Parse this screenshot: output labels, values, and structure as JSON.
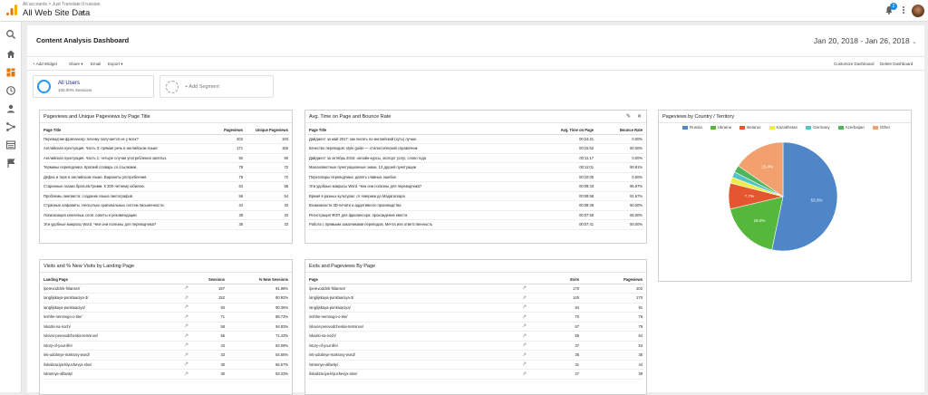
{
  "header": {
    "breadcrumb": "All accounts > Just Translate It russian",
    "account_view": "All Web Site Data",
    "notifications_count": "2"
  },
  "dashboard": {
    "title": "Content Analysis Dashboard",
    "date_range": "Jan 20, 2018 - Jan 26, 2018"
  },
  "toolbar": {
    "add_widget": "+ Add Widget",
    "share": "Share",
    "email": "Email",
    "export": "Export",
    "customize": "Customize Dashboard",
    "delete": "Delete Dashboard"
  },
  "segments": {
    "active_name": "All Users",
    "active_sub": "100.00% Sessions",
    "add_label": "+ Add Segment"
  },
  "widget1": {
    "title": "Pageviews and Unique Pageviews by Page Title",
    "headers": [
      "Page Title",
      "Pageviews",
      "Unique Pageviews"
    ],
    "rows": [
      [
        "Переводчик-фрилансер: почему получается не у всех?",
        "202",
        "193"
      ],
      [
        "Английская пунктуация. Часть 3: прямая речь в английском языке",
        "171",
        "155"
      ],
      [
        "Английская пунктуация. Часть 1: четыре случая употребления запятых.",
        "92",
        "90"
      ],
      [
        "Термины переводчика. Краткий словарь со ссылками.",
        "79",
        "72"
      ],
      [
        "Дефис и тире в английском языке. Варианты употребления.",
        "76",
        "72"
      ],
      [
        "Старинные сказки братьев Гримм. К 200-летнему юбилею.",
        "64",
        "58"
      ],
      [
        "Проблемы лингвиста: создание языка пиктографов",
        "56",
        "54"
      ],
      [
        "Странные алфавиты. Несколько оригинальных систем письменности.",
        "44",
        "33"
      ],
      [
        "Локализация ключевых слов: советы и рекомендации",
        "39",
        "33"
      ],
      [
        "Эти удобные макросы Word. Чем они полезны для переводчика?",
        "35",
        "33"
      ]
    ]
  },
  "widget2": {
    "title": "Avg. Time on Page and Bounce Rate",
    "headers": [
      "Page Title",
      "Avg. Time on Page",
      "Bounce Rate"
    ],
    "rows": [
      [
        "Дайджест за май 2017: как писать по-английский (хуть) лучше.",
        "00:24:21",
        "0.00%"
      ],
      [
        "Качество переводов: style guide — стилистический справочник",
        "00:15:52",
        "60.00%"
      ],
      [
        "Дайджест за октябрь 2016: онлайн-курсы, экспорт услуг, слово года",
        "00:11:17",
        "0.00%"
      ],
      [
        "Малоизвестные пунктуационные знаки. 13 друзей пунктуации",
        "00:11:01",
        "90.91%"
      ],
      [
        "Переговоры переводчика: девять главных ошибок",
        "00:10:05",
        "0.00%"
      ],
      [
        "Эти удобные макросы Word. Чем они полезны для переводчика?",
        "00:09:33",
        "96.97%"
      ],
      [
        "Время в разных культурах: от Америки до Мадагаскара",
        "00:08:58",
        "91.67%"
      ],
      [
        "Возможности 3D-печати и аддитивного производства",
        "00:08:36",
        "50.00%"
      ],
      [
        "Регистрация ФОП для фрилансера: прохождение квеста",
        "00:07:55",
        "65.00%"
      ],
      [
        "Работа с прямыми заказчиками переводов. Мечта или ответственность",
        "00:07:41",
        "50.00%"
      ]
    ]
  },
  "widget3": {
    "title": "Pageviews by Country / Territory",
    "legend": [
      "Russia",
      "Ukraine",
      "Belarus",
      "Kazakhstan",
      "Germany",
      "Azerbaijan",
      "Other"
    ],
    "colors": [
      "#4e86c7",
      "#55b83d",
      "#e4562f",
      "#eeec4a",
      "#57c4c4",
      "#4fb55b",
      "#f2a06d"
    ]
  },
  "widget4": {
    "title": "Visits and % New Visits by Landing Page",
    "headers": [
      "Landing Page",
      "Sessions",
      "% New Sessions"
    ],
    "rows": [
      [
        "/perevodchik-frilanser/",
        "187",
        "91.98%"
      ],
      [
        "/anglijskaya-punktuaciya-3/",
        "152",
        "80.92%"
      ],
      [
        "/anglijskaya-punktuaciya/",
        "83",
        "90.36%"
      ],
      [
        "/eshhe-nemnogo-o-tire/",
        "71",
        "88.73%"
      ],
      [
        "/skazki-na-noch/",
        "58",
        "94.83%"
      ],
      [
        "/slovar-perevodcheskix-terminov/",
        "56",
        "71.43%"
      ],
      [
        "/story-of-your-life/",
        "44",
        "84.09%"
      ],
      [
        "/eti-udobnye-makrosy-word/",
        "33",
        "54.55%"
      ],
      [
        "/lokalizaciya-klyuchevyx-slov/",
        "30",
        "66.67%"
      ],
      [
        "/strannye-alfavity/",
        "30",
        "93.33%"
      ]
    ]
  },
  "widget5": {
    "title": "Exits and Pageviews By Page",
    "headers": [
      "Page",
      "Exits",
      "Pageviews"
    ],
    "rows": [
      [
        "/perevodchik-frilanser/",
        "170",
        "202"
      ],
      [
        "/anglijskaya-punktuaciya-3/",
        "145",
        "170"
      ],
      [
        "/anglijskaya-punktuaciya/",
        "84",
        "91"
      ],
      [
        "/eshhe-nemnogo-o-tire/",
        "70",
        "76"
      ],
      [
        "/slovar-perevodcheskix-terminov/",
        "67",
        "79"
      ],
      [
        "/skazki-na-noch/",
        "55",
        "64"
      ],
      [
        "/story-of-your-life/",
        "37",
        "53"
      ],
      [
        "/eti-udobnye-makrosy-word/",
        "35",
        "35"
      ],
      [
        "/strannye-alfavity/",
        "31",
        "44"
      ],
      [
        "/lokalizaciya-klyuchevyx-slov/",
        "27",
        "39"
      ]
    ]
  },
  "chart_data": {
    "type": "pie",
    "categories": [
      "Russia",
      "Ukraine",
      "Belarus",
      "Kazakhstan",
      "Germany",
      "Azerbaijan",
      "Other"
    ],
    "values": [
      53.3,
      18.0,
      7.7,
      1.8,
      1.7,
      2.1,
      15.4
    ],
    "data_labels": [
      "53.3%",
      "18.0%",
      "7.7%",
      "",
      "",
      "",
      "15.4%"
    ],
    "legend_position": "top"
  }
}
